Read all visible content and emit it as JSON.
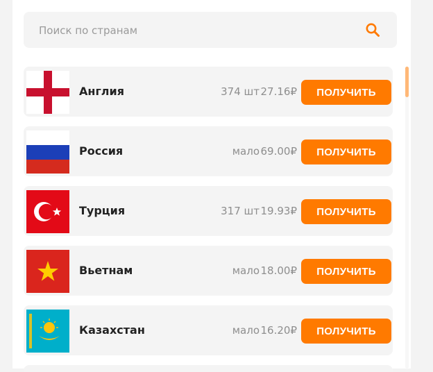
{
  "search": {
    "placeholder": "Поиск по странам",
    "icon": "search-icon",
    "icon_color": "#ff7a00"
  },
  "accent_color": "#ff7a00",
  "countries": [
    {
      "name": "Англия",
      "stock": "374 шт",
      "price": "27.16₽",
      "button": "ПОЛУЧИТЬ",
      "flag": "england-flag-icon"
    },
    {
      "name": "Россия",
      "stock": "мало",
      "price": "69.00₽",
      "button": "ПОЛУЧИТЬ",
      "flag": "russia-flag-icon"
    },
    {
      "name": "Турция",
      "stock": "317 шт",
      "price": "19.93₽",
      "button": "ПОЛУЧИТЬ",
      "flag": "turkey-flag-icon"
    },
    {
      "name": "Вьетнам",
      "stock": "мало",
      "price": "18.00₽",
      "button": "ПОЛУЧИТЬ",
      "flag": "vietnam-flag-icon"
    },
    {
      "name": "Казахстан",
      "stock": "мало",
      "price": "16.20₽",
      "button": "ПОЛУЧИТЬ",
      "flag": "kazakhstan-flag-icon"
    }
  ]
}
